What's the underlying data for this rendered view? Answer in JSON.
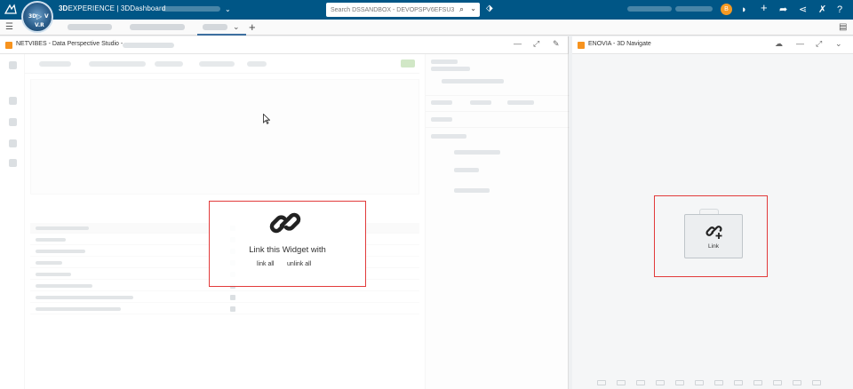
{
  "topbar": {
    "brand_bold": "3D",
    "brand_rest": "EXPERIENCE | 3DDashboard",
    "compass_labels": [
      "3D",
      "▷",
      "V",
      "V.R"
    ],
    "search_placeholder": "Search DSSANDBOX - DEVOPSPV6EFSU3",
    "avatar_initial": "B"
  },
  "colors": {
    "topbar": "#005686",
    "accent_red": "#e23b3b",
    "widget_icon": "#f7931e"
  },
  "icons": {
    "ds_logo": "3ds-logo-icon",
    "compass": "compass-icon",
    "search": "search-icon",
    "tag": "tag-icon",
    "plus": "plus-icon",
    "share": "share-icon",
    "network": "network-icon",
    "tools": "tools-icon",
    "help": "help-icon",
    "menu": "hamburger-menu-icon",
    "chat": "chat-icon",
    "link_chain": "chain-link-icon",
    "link_add": "link-add-icon"
  },
  "left_widget": {
    "title": "NETVIBES - Data Perspective Studio - ",
    "link_overlay": {
      "heading": "Link this Widget with",
      "link_all": "link all",
      "unlink_all": "unlink all"
    }
  },
  "right_widget": {
    "title": "ENOVIA - 3D Navigate",
    "link_tile_label": "Link"
  }
}
